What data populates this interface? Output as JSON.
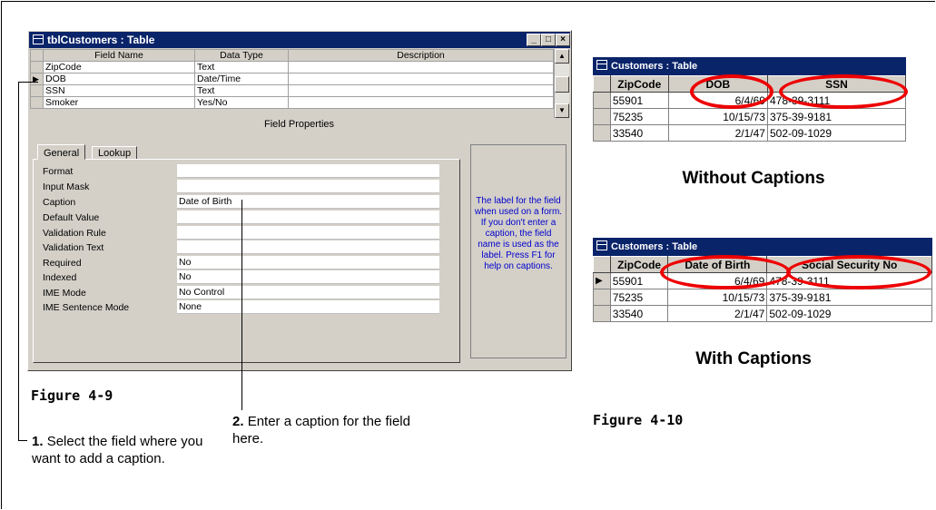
{
  "design_window": {
    "title": "tblCustomers : Table",
    "columns": [
      "Field Name",
      "Data Type",
      "Description"
    ],
    "rows": [
      {
        "field": "ZipCode",
        "type": "Text",
        "desc": ""
      },
      {
        "field": "DOB",
        "type": "Date/Time",
        "desc": ""
      },
      {
        "field": "SSN",
        "type": "Text",
        "desc": ""
      },
      {
        "field": "Smoker",
        "type": "Yes/No",
        "desc": ""
      }
    ],
    "field_properties_label": "Field Properties",
    "tabs": [
      "General",
      "Lookup"
    ],
    "properties": [
      {
        "label": "Format",
        "value": ""
      },
      {
        "label": "Input Mask",
        "value": ""
      },
      {
        "label": "Caption",
        "value": "Date of Birth"
      },
      {
        "label": "Default Value",
        "value": ""
      },
      {
        "label": "Validation Rule",
        "value": ""
      },
      {
        "label": "Validation Text",
        "value": ""
      },
      {
        "label": "Required",
        "value": "No"
      },
      {
        "label": "Indexed",
        "value": "No"
      },
      {
        "label": "IME Mode",
        "value": "No Control"
      },
      {
        "label": "IME Sentence Mode",
        "value": "None"
      }
    ],
    "help_text": "The label for the field when used on a form.  If you don't enter a caption, the field name is used as the label.  Press F1 for help on captions."
  },
  "figure_left": "Figure 4-9",
  "figure_right": "Figure 4-10",
  "steps": [
    {
      "num": "1.",
      "text": "Select the field where you want to add a caption."
    },
    {
      "num": "2.",
      "text": "Enter a caption for the field here."
    }
  ],
  "sheet_without": {
    "title": "Customers : Table",
    "headers": [
      "ZipCode",
      "DOB",
      "SSN"
    ],
    "rows": [
      [
        "55901",
        "6/4/69",
        "478-39-3111"
      ],
      [
        "75235",
        "10/15/73",
        "375-39-9181"
      ],
      [
        "33540",
        "2/1/47",
        "502-09-1029"
      ]
    ],
    "caption": "Without Captions"
  },
  "sheet_with": {
    "title": "Customers : Table",
    "headers": [
      "ZipCode",
      "Date of Birth",
      "Social Security No"
    ],
    "rows": [
      [
        "55901",
        "6/4/69",
        "478-39-3111"
      ],
      [
        "75235",
        "10/15/73",
        "375-39-9181"
      ],
      [
        "33540",
        "2/1/47",
        "502-09-1029"
      ]
    ],
    "caption": "With Captions"
  },
  "colors": {
    "titlebar": "#0a246a",
    "help_text": "#0000cc",
    "highlight": "#e00000"
  }
}
